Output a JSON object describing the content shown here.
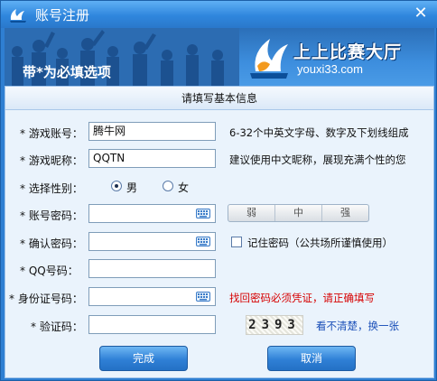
{
  "window": {
    "title": "账号注册",
    "close_label": "✕"
  },
  "banner": {
    "note": "带*为必填选项",
    "brand_name": "上上比赛大厅",
    "brand_url": "youxi33.com"
  },
  "section": {
    "title": "请填写基本信息"
  },
  "fields": {
    "account": {
      "label": "* 游戏账号：",
      "value": "腾牛网",
      "hint": "6-32个中英文字母、数字及下划线组成"
    },
    "nickname": {
      "label": "* 游戏昵称：",
      "value": "QQTN",
      "hint": "建议使用中文昵称，展现充满个性的您"
    },
    "gender": {
      "label": "* 选择性别：",
      "options": [
        "男",
        "女"
      ],
      "selected": "男"
    },
    "password": {
      "label": "* 账号密码：",
      "value": "",
      "strength": [
        "弱",
        "中",
        "强"
      ]
    },
    "confirm": {
      "label": "* 确认密码：",
      "value": "",
      "remember_label": "记住密码（公共场所谨慎使用）",
      "remember_checked": false
    },
    "qq": {
      "label": "* QQ号码：",
      "value": ""
    },
    "idcard": {
      "label": "* 身份证号码：",
      "value": "",
      "hint": "找回密码必须凭证，请正确填写"
    },
    "captcha": {
      "label": "* 验证码：",
      "value": "",
      "code": "2393",
      "refresh_label": "看不清楚，换一张"
    }
  },
  "buttons": {
    "submit": "完成",
    "cancel": "取消"
  },
  "colors": {
    "title_bar": "#2f86dd",
    "panel_bg": "#eaf3fc",
    "error_text": "#d60000",
    "link_text": "#1a4fb8"
  }
}
